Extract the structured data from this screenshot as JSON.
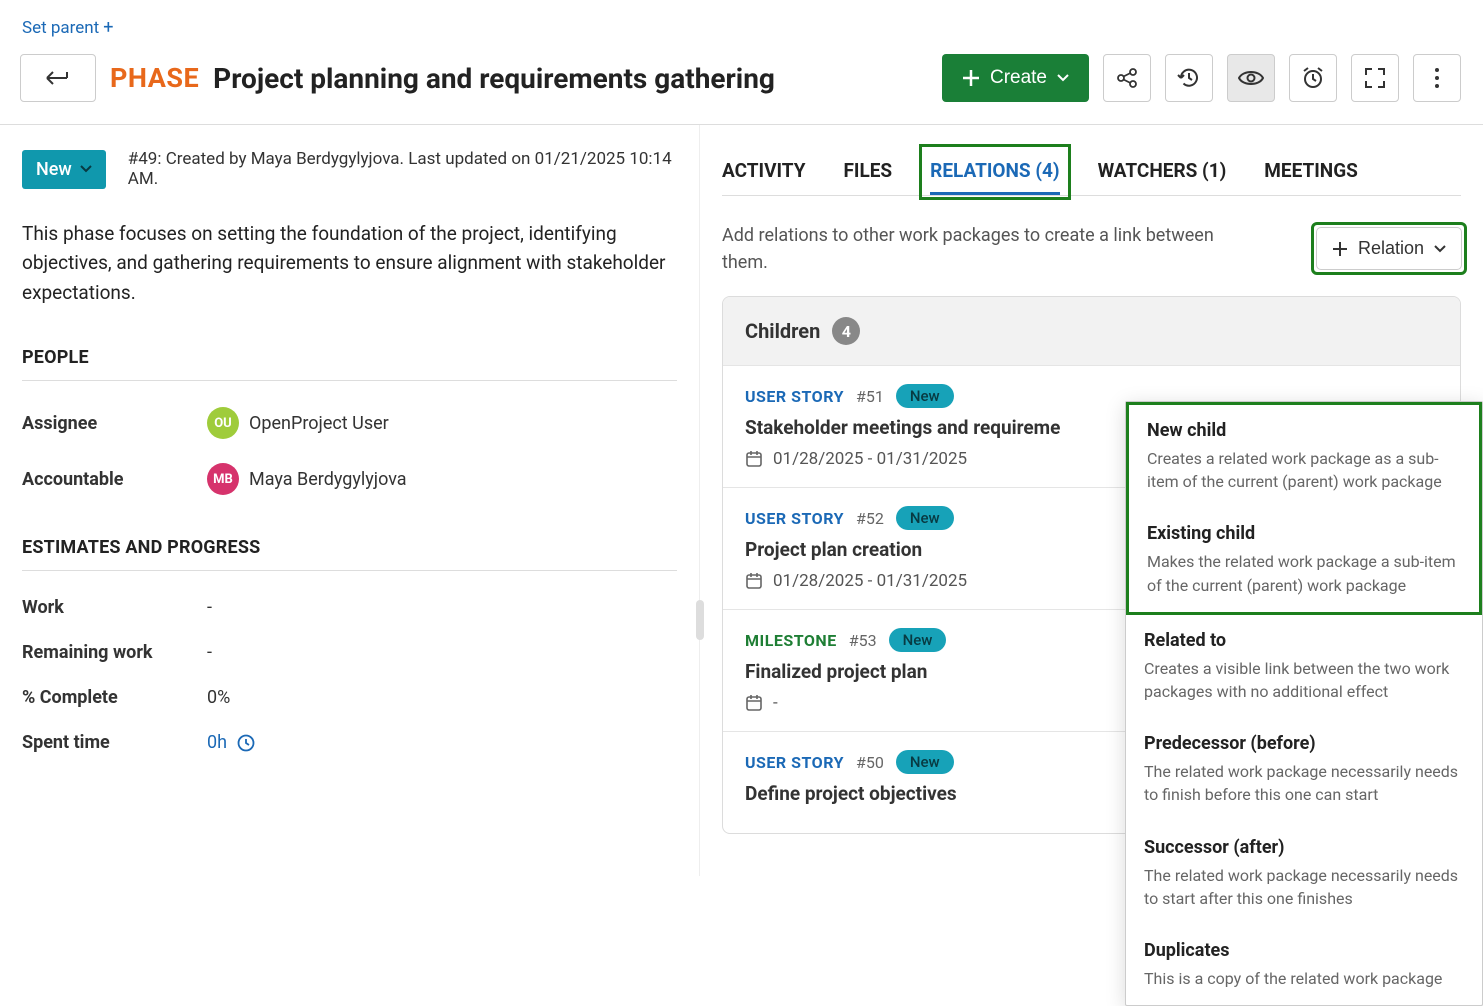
{
  "set_parent": {
    "label": "Set parent"
  },
  "header": {
    "type_badge": "PHASE",
    "title": "Project planning and requirements gathering",
    "create_label": "Create"
  },
  "status": {
    "chip_label": "New",
    "meta": "#49: Created by Maya Berdygylyjova. Last updated on 01/21/2025 10:14 AM."
  },
  "description": "This phase focuses on setting the foundation of the project, identifying objectives, and gathering requirements to ensure alignment with stakeholder expectations.",
  "people": {
    "section_title": "PEOPLE",
    "assignee_label": "Assignee",
    "assignee_initials": "OU",
    "assignee_name": "OpenProject User",
    "assignee_avatar_color": "#9fcc3b",
    "accountable_label": "Accountable",
    "accountable_initials": "MB",
    "accountable_name": "Maya Berdygylyjova",
    "accountable_avatar_color": "#d6336c"
  },
  "estimates": {
    "section_title": "ESTIMATES AND PROGRESS",
    "work_label": "Work",
    "work_value": "-",
    "remaining_label": "Remaining work",
    "remaining_value": "-",
    "complete_label": "% Complete",
    "complete_value": "0%",
    "spent_label": "Spent time",
    "spent_value": "0h"
  },
  "tabs": {
    "activity": "ACTIVITY",
    "files": "FILES",
    "relations": "RELATIONS (4)",
    "watchers": "WATCHERS (1)",
    "meetings": "MEETINGS"
  },
  "relations": {
    "help": "Add relations to other work packages to create a link between them.",
    "button_label": "Relation",
    "children_label": "Children",
    "children_count": "4",
    "children": [
      {
        "type": "USER STORY",
        "type_class": "type-user-story",
        "id": "#51",
        "status": "New",
        "title": "Stakeholder meetings and requireme",
        "dates": "01/28/2025 - 01/31/2025"
      },
      {
        "type": "USER STORY",
        "type_class": "type-user-story",
        "id": "#52",
        "status": "New",
        "title": "Project plan creation",
        "dates": "01/28/2025 - 01/31/2025"
      },
      {
        "type": "MILESTONE",
        "type_class": "type-milestone",
        "id": "#53",
        "status": "New",
        "title": "Finalized project plan",
        "dates": "-"
      },
      {
        "type": "USER STORY",
        "type_class": "type-user-story",
        "id": "#50",
        "status": "New",
        "title": "Define project objectives",
        "dates": ""
      }
    ]
  },
  "dropdown": [
    {
      "title": "New child",
      "desc": "Creates a related work package as a sub-item of the current (parent) work package",
      "hl": true
    },
    {
      "title": "Existing child",
      "desc": "Makes the related work package a sub-item of the current (parent) work package",
      "hl": true
    },
    {
      "title": "Related to",
      "desc": "Creates a visible link between the two work packages with no additional effect",
      "hl": false
    },
    {
      "title": "Predecessor (before)",
      "desc": "The related work package necessarily needs to finish before this one can start",
      "hl": false
    },
    {
      "title": "Successor (after)",
      "desc": "The related work package necessarily needs to start after this one finishes",
      "hl": false
    },
    {
      "title": "Duplicates",
      "desc": "This is a copy of the related work package",
      "hl": false
    }
  ]
}
